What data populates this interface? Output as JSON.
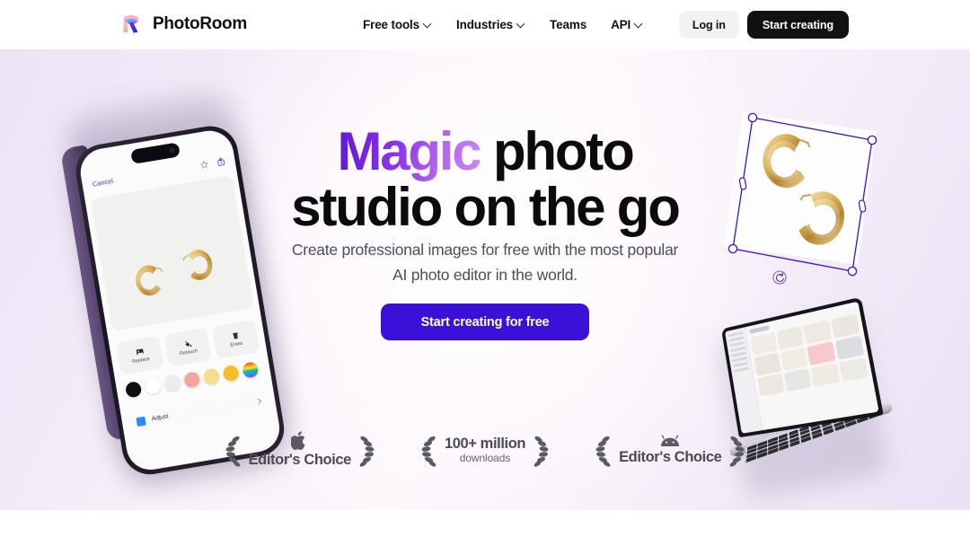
{
  "header": {
    "brand": {
      "name": "PhotoRoom",
      "logo_icon": "photoroom-r-logo-icon"
    },
    "nav": [
      {
        "label": "Free tools",
        "has_dropdown": true
      },
      {
        "label": "Industries",
        "has_dropdown": true
      },
      {
        "label": "Teams",
        "has_dropdown": false
      },
      {
        "label": "API",
        "has_dropdown": true
      }
    ],
    "login_label": "Log in",
    "start_label": "Start creating"
  },
  "hero": {
    "headline_accent": "Magic",
    "headline_rest": " photo",
    "headline_line2": "studio on the go",
    "subhead_line1": "Create professional images for free with the most popular",
    "subhead_line2": "AI photo editor in the world.",
    "cta_label": "Start creating for free"
  },
  "badges": [
    {
      "os_icon": "apple-icon",
      "title": "Editor's Choice",
      "subtitle": ""
    },
    {
      "os_icon": "",
      "title": "100+ million",
      "subtitle": "downloads"
    },
    {
      "os_icon": "android-icon",
      "title": "Editor's Choice",
      "subtitle": ""
    }
  ],
  "phone_mockup": {
    "cancel_label": "Cancel",
    "star_icon": "star-outline-icon",
    "share_icon": "share-icon",
    "tools": [
      {
        "label": "Replace",
        "icon": "image-replace-icon"
      },
      {
        "label": "Retouch",
        "icon": "paint-bucket-icon"
      },
      {
        "label": "Erase",
        "icon": "eraser-icon"
      }
    ],
    "swatches": [
      "#0d0d0d",
      "#ffffff",
      "#ececed",
      "#f4a49c",
      "#f6dd8e",
      "#f6bf24",
      "rainbow"
    ],
    "adjust_label": "Adjust",
    "adjust_chevron_icon": "chevron-right-icon"
  },
  "cutout": {
    "selection_handles": 8,
    "rotate_icon": "rotate-handle-icon",
    "selection_color": "#3b11da"
  },
  "colors": {
    "accent": "#3b11da",
    "dark": "#111113",
    "bg_lavender": "#ece4f6",
    "magic_gradient_start": "#5b16d6",
    "magic_gradient_end": "#c98af2"
  }
}
